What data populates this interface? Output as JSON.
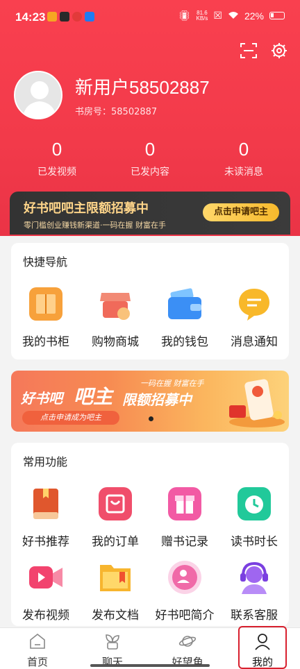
{
  "status_bar": {
    "time": "14:23",
    "net_speed_top": "81.6",
    "net_speed_bottom": "KB/s",
    "battery": "22%"
  },
  "colors": {
    "brand_red": "#f23a4a",
    "gold": "#ffd58a",
    "accent_orange": "#f7b92c"
  },
  "header": {
    "scan_icon": "scan-icon",
    "settings_icon": "gear-icon"
  },
  "profile": {
    "username": "新用户58502887",
    "room_id": "书房号：58502887"
  },
  "stats": [
    {
      "value": "0",
      "label": "已发视频"
    },
    {
      "value": "0",
      "label": "已发内容"
    },
    {
      "value": "0",
      "label": "未读消息"
    }
  ],
  "promo_strip": {
    "title": "好书吧吧主限额招募中",
    "subtitle": "零门槛创业赚钱新渠道·一码在握 财富在手",
    "button": "点击申请吧主"
  },
  "quick_nav": {
    "title": "快捷导航",
    "items": [
      {
        "label": "我的书柜",
        "icon": "bookshelf-icon"
      },
      {
        "label": "购物商城",
        "icon": "shop-icon"
      },
      {
        "label": "我的钱包",
        "icon": "wallet-icon"
      },
      {
        "label": "消息通知",
        "icon": "message-icon"
      }
    ]
  },
  "banner": {
    "brand": "好书吧",
    "host": "吧主",
    "slogan": "一码在握 财富在手",
    "headline": "限额招募中",
    "cta": "点击申请成为吧主"
  },
  "common": {
    "title": "常用功能",
    "items": [
      {
        "label": "好书推荐",
        "icon": "book-icon"
      },
      {
        "label": "我的订单",
        "icon": "order-bag-icon"
      },
      {
        "label": "赠书记录",
        "icon": "gift-icon"
      },
      {
        "label": "读书时长",
        "icon": "alarm-clock-icon"
      },
      {
        "label": "发布视频",
        "icon": "video-camera-icon"
      },
      {
        "label": "发布文档",
        "icon": "folder-icon"
      },
      {
        "label": "好书吧简介",
        "icon": "profile-badge-icon"
      },
      {
        "label": "联系客服",
        "icon": "headset-icon"
      }
    ]
  },
  "tabbar": [
    {
      "label": "首页",
      "icon": "home-icon"
    },
    {
      "label": "聊天",
      "icon": "sprout-icon"
    },
    {
      "label": "好望角",
      "icon": "planet-icon"
    },
    {
      "label": "我的",
      "icon": "person-icon"
    }
  ]
}
